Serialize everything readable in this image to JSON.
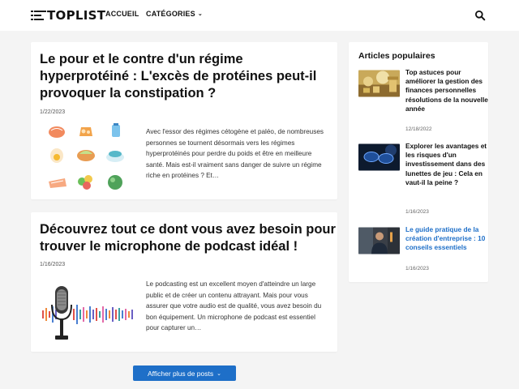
{
  "header": {
    "logo_text": "TOPLIST",
    "nav": {
      "home": "ACCUEIL",
      "categories": "CATÉGORIES"
    },
    "icons": {
      "search": "search-icon",
      "chevron": "chevron-down-icon"
    }
  },
  "posts": [
    {
      "title_line1": "Le pour et le contre d'un régime",
      "title_line2": "hyperprotéiné : L'excès de protéines peut-il",
      "title_line3": "provoquer la constipation ?",
      "date": "1/22/2023",
      "excerpt": "Avec l'essor des régimes cétogène et paléo, de nombreuses personnes se tournent désormais vers les régimes hyperprotéinés pour perdre du poids et être en meilleure santé. Mais est-il vraiment sans danger de suivre un régime riche en protéines ? Et…",
      "thumbnail": "protein-foods-illustration"
    },
    {
      "title_line1": "Découvrez tout ce dont vous avez besoin pour",
      "title_line2": "trouver le microphone de podcast idéal !",
      "date": "1/16/2023",
      "excerpt": "Le podcasting est un excellent moyen d'atteindre un large public et de créer un contenu attrayant. Mais pour vous assurer que votre audio est de qualité, vous avez besoin du bon équipement. Un microphone de podcast est essentiel pour capturer un…",
      "thumbnail": "podcast-microphone-illustration"
    }
  ],
  "load_more": "Afficher plus de posts",
  "sidebar": {
    "title": "Articles populaires",
    "items": [
      {
        "title": "Top astuces pour améliorer la gestion des finances personnelles résolutions de la nouvelle année",
        "date": "12/18/2022",
        "highlight": false
      },
      {
        "title": "Explorer les avantages et les risques d'un investissement dans des lunettes de jeu : Cela en vaut-il la peine ?",
        "date": "1/16/2023",
        "highlight": false
      },
      {
        "title": "Le guide pratique de la création d'entreprise : 10 conseils essentiels",
        "date": "1/16/2023",
        "highlight": true
      }
    ]
  },
  "colors": {
    "accent": "#1e6fc8",
    "background": "#f4f4f4",
    "card": "#ffffff"
  }
}
